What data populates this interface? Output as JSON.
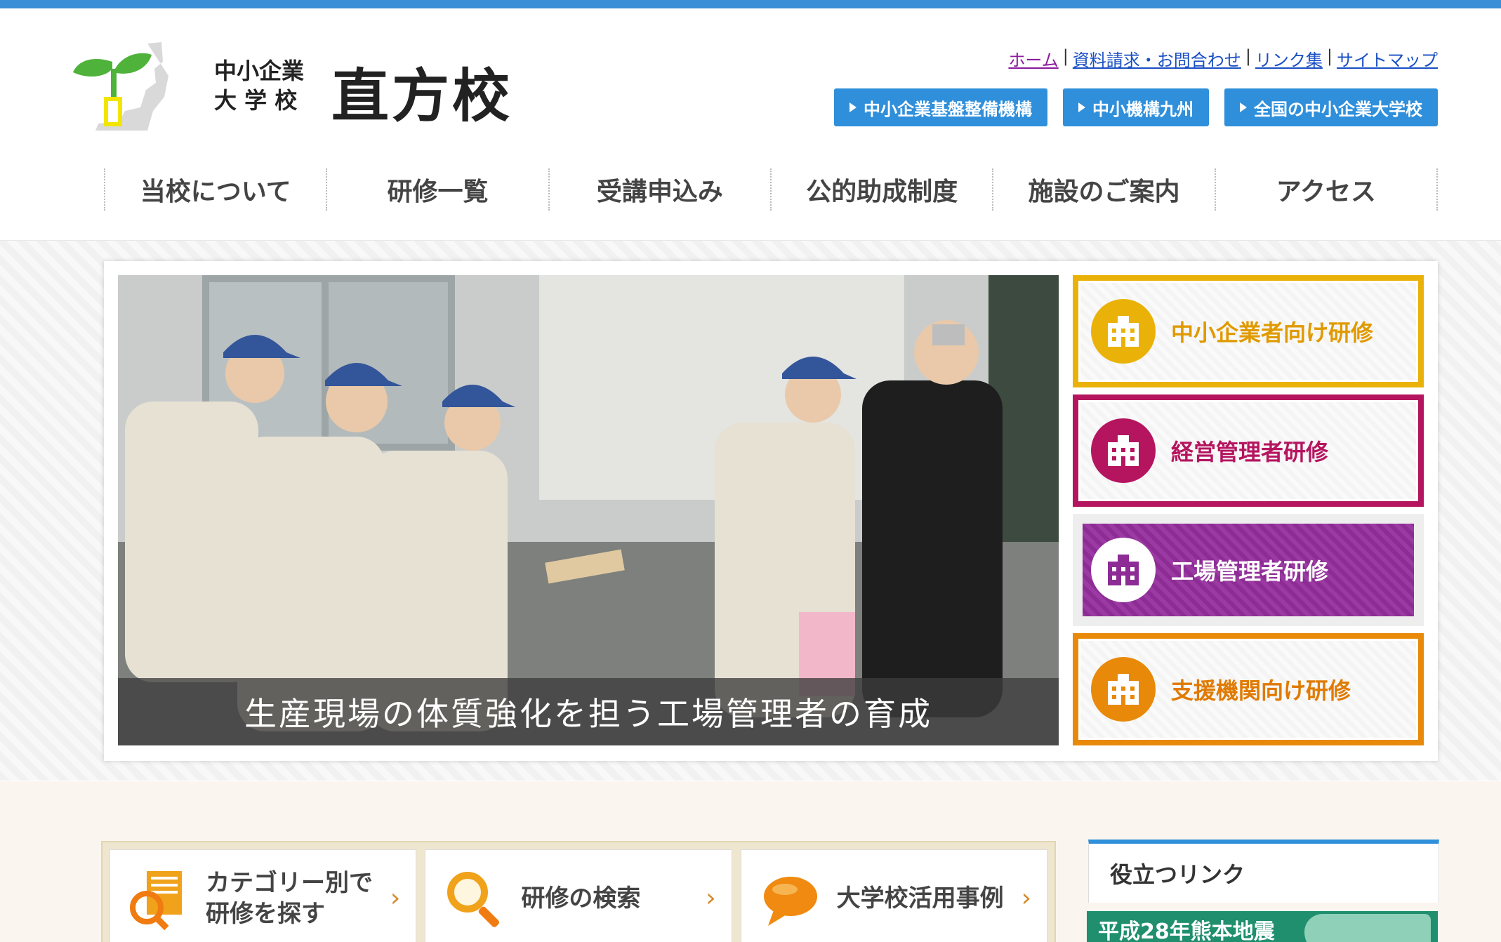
{
  "header": {
    "logo_small_line1": "中小企業",
    "logo_small_line2": "大 学 校",
    "logo_big": "直方校"
  },
  "util_links": [
    "ホーム",
    "資料請求・お問合わせ",
    "リンク集",
    "サイトマップ"
  ],
  "org_buttons": [
    "中小企業基盤整備機構",
    "中小機構九州",
    "全国の中小企業大学校"
  ],
  "nav": [
    "当校について",
    "研修一覧",
    "受講申込み",
    "公的助成制度",
    "施設のご案内",
    "アクセス"
  ],
  "hero": {
    "caption": "生産現場の体質強化を担う工場管理者の育成"
  },
  "side_buttons": [
    {
      "label": "中小企業者向け研修",
      "color": "#eab208",
      "text_color": "#e09a00"
    },
    {
      "label": "経営管理者研修",
      "color": "#b5155f",
      "text_color": "#b5155f"
    },
    {
      "label": "工場管理者研修",
      "color": "#8c2c94",
      "text_color": "#ffffff"
    },
    {
      "label": "支援機関向け研修",
      "color": "#e8890a",
      "text_color": "#e07a00"
    }
  ],
  "cards": [
    {
      "line1": "カテゴリー別で",
      "line2": "研修を探す",
      "icon": "document-search-icon"
    },
    {
      "line1": "研修の検索",
      "line2": "",
      "icon": "magnifier-icon"
    },
    {
      "line1": "大学校活用事例",
      "line2": "",
      "icon": "speech-bubble-icon"
    }
  ],
  "useful_links": {
    "title": "役立つリンク",
    "banner": "平成28年熊本地震"
  }
}
